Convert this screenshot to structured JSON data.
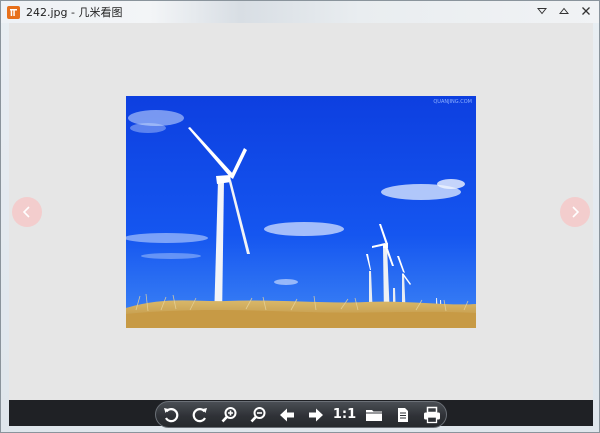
{
  "window": {
    "title": "242.jpg -  几米看图"
  },
  "viewer": {
    "image_watermark": "QUANJING.COM"
  },
  "toolbar": {
    "items": [
      {
        "icon": "rotate-left-icon"
      },
      {
        "icon": "rotate-right-icon"
      },
      {
        "icon": "zoom-in-icon"
      },
      {
        "icon": "zoom-out-icon"
      },
      {
        "icon": "previous-arrow-icon"
      },
      {
        "icon": "next-arrow-icon"
      },
      {
        "label": "1:1"
      },
      {
        "icon": "folder-icon"
      },
      {
        "icon": "properties-icon"
      },
      {
        "icon": "print-icon"
      }
    ],
    "actual_size_label": "1:1"
  },
  "colors": {
    "viewer_bg": "#e6e6e6",
    "toolbar_bg": "#2f3237",
    "nav_arrow_bg": "#f3cdcd",
    "app_icon": "#e7701b",
    "sky": "#1447e0"
  }
}
